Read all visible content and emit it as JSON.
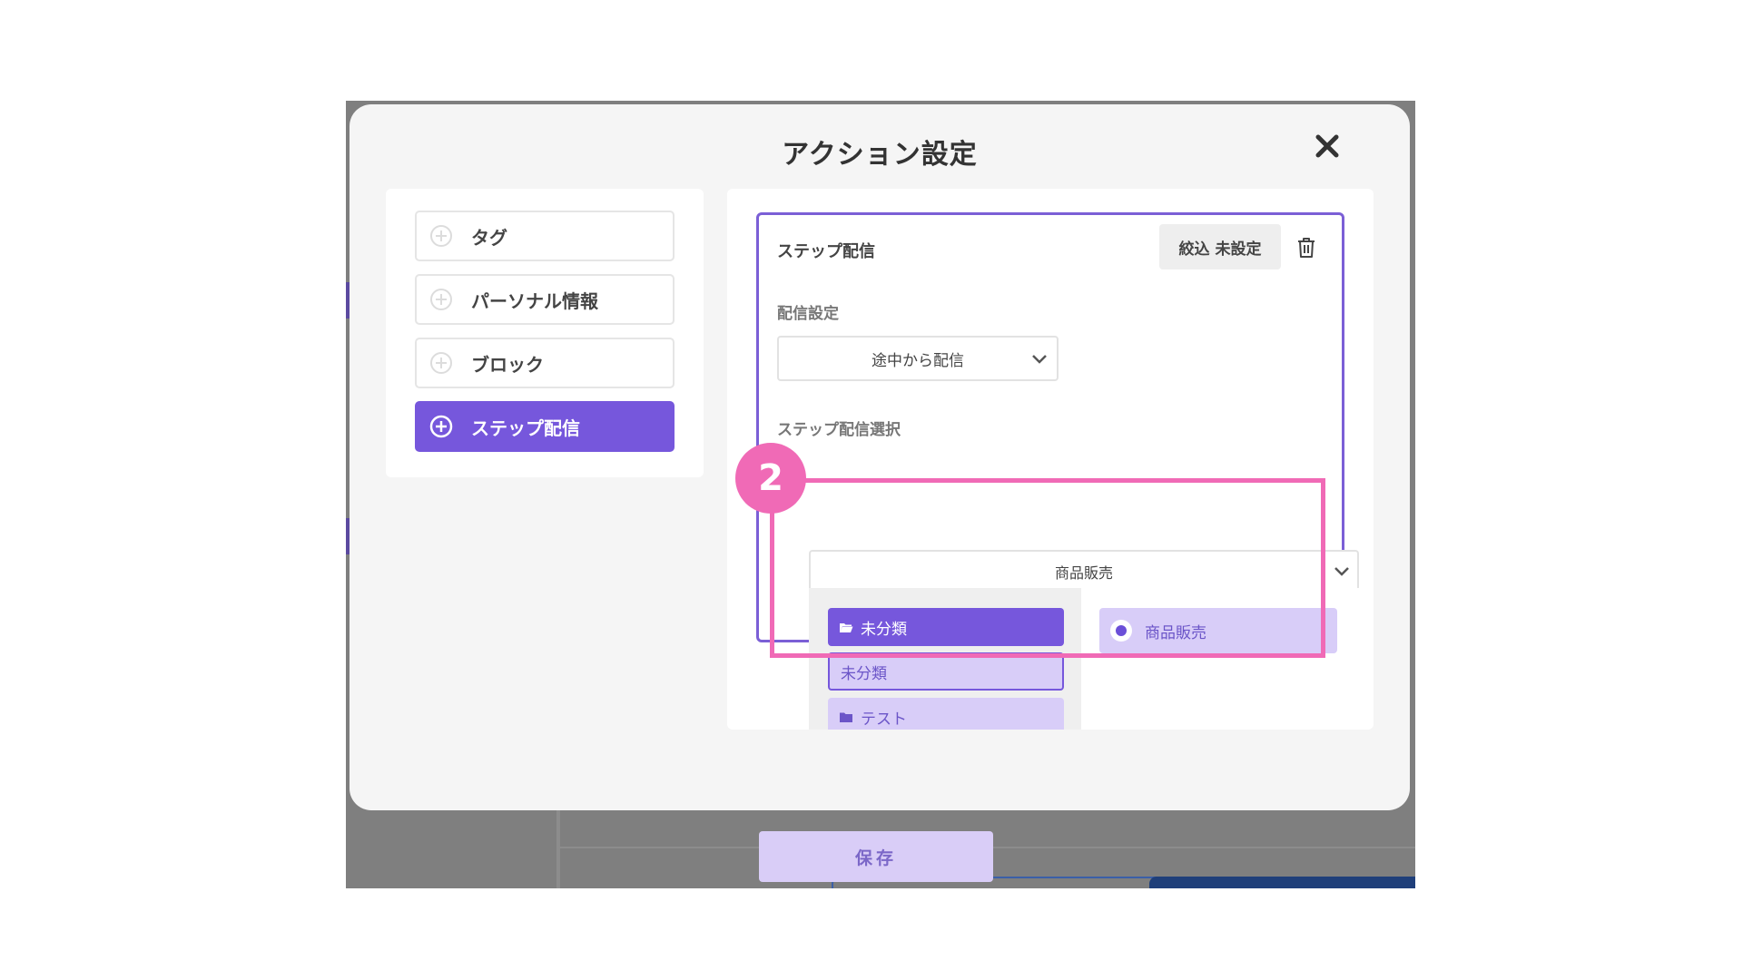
{
  "modal": {
    "title": "アクション設定"
  },
  "action_list": {
    "items": [
      {
        "label": "タグ",
        "active": false
      },
      {
        "label": "パーソナル情報",
        "active": false
      },
      {
        "label": "ブロック",
        "active": false
      },
      {
        "label": "ステップ配信",
        "active": true
      }
    ]
  },
  "step_card": {
    "title": "ステップ配信",
    "filter_label": "絞込 未設定",
    "delivery_label": "配信設定",
    "delivery_value": "途中から配信",
    "step_select_label": "ステップ配信選択",
    "step_select_value": "商品販売"
  },
  "dropdown": {
    "folders": [
      {
        "label": "未分類",
        "state": "selected",
        "icon": "folder-open-icon"
      },
      {
        "label": "未分類",
        "state": "hover",
        "icon": ""
      },
      {
        "label": "テスト",
        "state": "normal",
        "icon": "folder-icon"
      }
    ],
    "options": [
      {
        "label": "商品販売",
        "selected": true
      }
    ]
  },
  "annotation": {
    "step_number": "2"
  },
  "footer": {
    "save_label": "保存"
  },
  "colors": {
    "accent": "#7657dc",
    "accent_light": "#d8cdf8",
    "highlight": "#f06ab6",
    "backdrop": "#7f7f7f"
  }
}
